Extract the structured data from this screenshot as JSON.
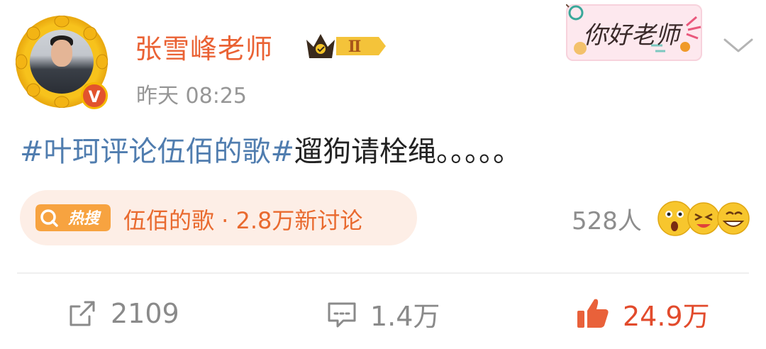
{
  "post": {
    "author": {
      "name": "张雪峰老师",
      "verified_badge": "V",
      "vip_level": "Ⅱ"
    },
    "timestamp": "昨天 08:25",
    "sticker_text": "你好老师",
    "hashtag": "#叶珂评论伍佰的歌#",
    "body": "遛狗请栓绳。。。。。",
    "hot_search": {
      "tag": "热搜",
      "text": "伍佰的歌 · 2.8万新讨论"
    },
    "reactions": {
      "count_label": "528人",
      "emoji_icons": [
        "surprised-emoji-icon",
        "laughing-emoji-icon",
        "grin-emoji-icon"
      ]
    },
    "actions": {
      "repost_count": "2109",
      "comment_count": "1.4万",
      "like_count": "24.9万"
    }
  },
  "colors": {
    "username": "#ea6234",
    "hashtag": "#507daf",
    "like_active": "#e24b2c",
    "hot_pill_bg": "#fdeee6"
  }
}
